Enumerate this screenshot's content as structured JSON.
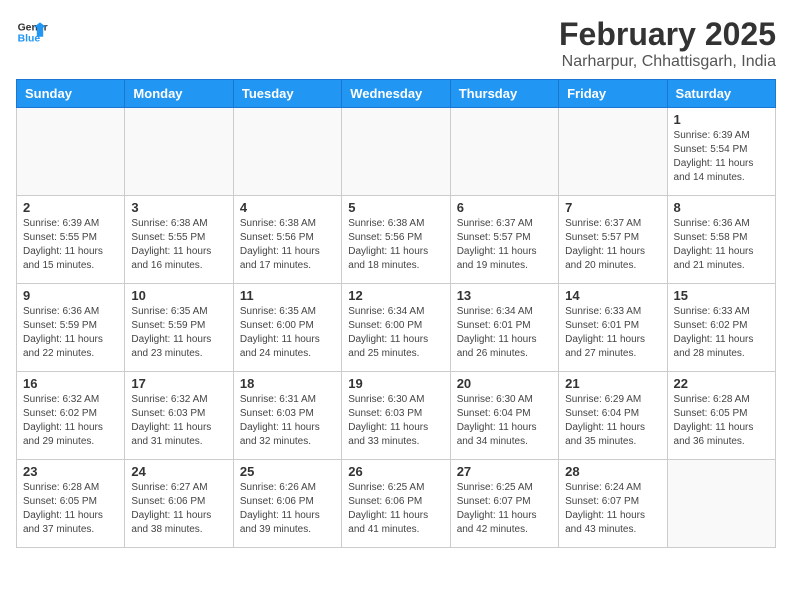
{
  "header": {
    "logo_line1": "General",
    "logo_line2": "Blue",
    "month_title": "February 2025",
    "location": "Narharpur, Chhattisgarh, India"
  },
  "weekdays": [
    "Sunday",
    "Monday",
    "Tuesday",
    "Wednesday",
    "Thursday",
    "Friday",
    "Saturday"
  ],
  "weeks": [
    [
      {
        "day": "",
        "info": ""
      },
      {
        "day": "",
        "info": ""
      },
      {
        "day": "",
        "info": ""
      },
      {
        "day": "",
        "info": ""
      },
      {
        "day": "",
        "info": ""
      },
      {
        "day": "",
        "info": ""
      },
      {
        "day": "1",
        "info": "Sunrise: 6:39 AM\nSunset: 5:54 PM\nDaylight: 11 hours and 14 minutes."
      }
    ],
    [
      {
        "day": "2",
        "info": "Sunrise: 6:39 AM\nSunset: 5:55 PM\nDaylight: 11 hours and 15 minutes."
      },
      {
        "day": "3",
        "info": "Sunrise: 6:38 AM\nSunset: 5:55 PM\nDaylight: 11 hours and 16 minutes."
      },
      {
        "day": "4",
        "info": "Sunrise: 6:38 AM\nSunset: 5:56 PM\nDaylight: 11 hours and 17 minutes."
      },
      {
        "day": "5",
        "info": "Sunrise: 6:38 AM\nSunset: 5:56 PM\nDaylight: 11 hours and 18 minutes."
      },
      {
        "day": "6",
        "info": "Sunrise: 6:37 AM\nSunset: 5:57 PM\nDaylight: 11 hours and 19 minutes."
      },
      {
        "day": "7",
        "info": "Sunrise: 6:37 AM\nSunset: 5:57 PM\nDaylight: 11 hours and 20 minutes."
      },
      {
        "day": "8",
        "info": "Sunrise: 6:36 AM\nSunset: 5:58 PM\nDaylight: 11 hours and 21 minutes."
      }
    ],
    [
      {
        "day": "9",
        "info": "Sunrise: 6:36 AM\nSunset: 5:59 PM\nDaylight: 11 hours and 22 minutes."
      },
      {
        "day": "10",
        "info": "Sunrise: 6:35 AM\nSunset: 5:59 PM\nDaylight: 11 hours and 23 minutes."
      },
      {
        "day": "11",
        "info": "Sunrise: 6:35 AM\nSunset: 6:00 PM\nDaylight: 11 hours and 24 minutes."
      },
      {
        "day": "12",
        "info": "Sunrise: 6:34 AM\nSunset: 6:00 PM\nDaylight: 11 hours and 25 minutes."
      },
      {
        "day": "13",
        "info": "Sunrise: 6:34 AM\nSunset: 6:01 PM\nDaylight: 11 hours and 26 minutes."
      },
      {
        "day": "14",
        "info": "Sunrise: 6:33 AM\nSunset: 6:01 PM\nDaylight: 11 hours and 27 minutes."
      },
      {
        "day": "15",
        "info": "Sunrise: 6:33 AM\nSunset: 6:02 PM\nDaylight: 11 hours and 28 minutes."
      }
    ],
    [
      {
        "day": "16",
        "info": "Sunrise: 6:32 AM\nSunset: 6:02 PM\nDaylight: 11 hours and 29 minutes."
      },
      {
        "day": "17",
        "info": "Sunrise: 6:32 AM\nSunset: 6:03 PM\nDaylight: 11 hours and 31 minutes."
      },
      {
        "day": "18",
        "info": "Sunrise: 6:31 AM\nSunset: 6:03 PM\nDaylight: 11 hours and 32 minutes."
      },
      {
        "day": "19",
        "info": "Sunrise: 6:30 AM\nSunset: 6:03 PM\nDaylight: 11 hours and 33 minutes."
      },
      {
        "day": "20",
        "info": "Sunrise: 6:30 AM\nSunset: 6:04 PM\nDaylight: 11 hours and 34 minutes."
      },
      {
        "day": "21",
        "info": "Sunrise: 6:29 AM\nSunset: 6:04 PM\nDaylight: 11 hours and 35 minutes."
      },
      {
        "day": "22",
        "info": "Sunrise: 6:28 AM\nSunset: 6:05 PM\nDaylight: 11 hours and 36 minutes."
      }
    ],
    [
      {
        "day": "23",
        "info": "Sunrise: 6:28 AM\nSunset: 6:05 PM\nDaylight: 11 hours and 37 minutes."
      },
      {
        "day": "24",
        "info": "Sunrise: 6:27 AM\nSunset: 6:06 PM\nDaylight: 11 hours and 38 minutes."
      },
      {
        "day": "25",
        "info": "Sunrise: 6:26 AM\nSunset: 6:06 PM\nDaylight: 11 hours and 39 minutes."
      },
      {
        "day": "26",
        "info": "Sunrise: 6:25 AM\nSunset: 6:06 PM\nDaylight: 11 hours and 41 minutes."
      },
      {
        "day": "27",
        "info": "Sunrise: 6:25 AM\nSunset: 6:07 PM\nDaylight: 11 hours and 42 minutes."
      },
      {
        "day": "28",
        "info": "Sunrise: 6:24 AM\nSunset: 6:07 PM\nDaylight: 11 hours and 43 minutes."
      },
      {
        "day": "",
        "info": ""
      }
    ]
  ]
}
